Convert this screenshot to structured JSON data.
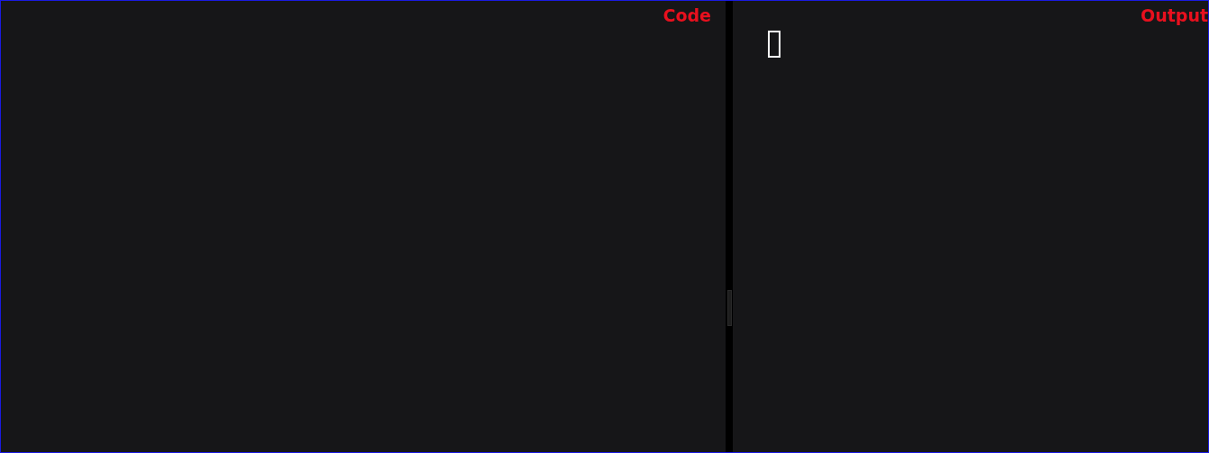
{
  "code_panel": {
    "label": "Code"
  },
  "output_panel": {
    "label": "Output"
  }
}
